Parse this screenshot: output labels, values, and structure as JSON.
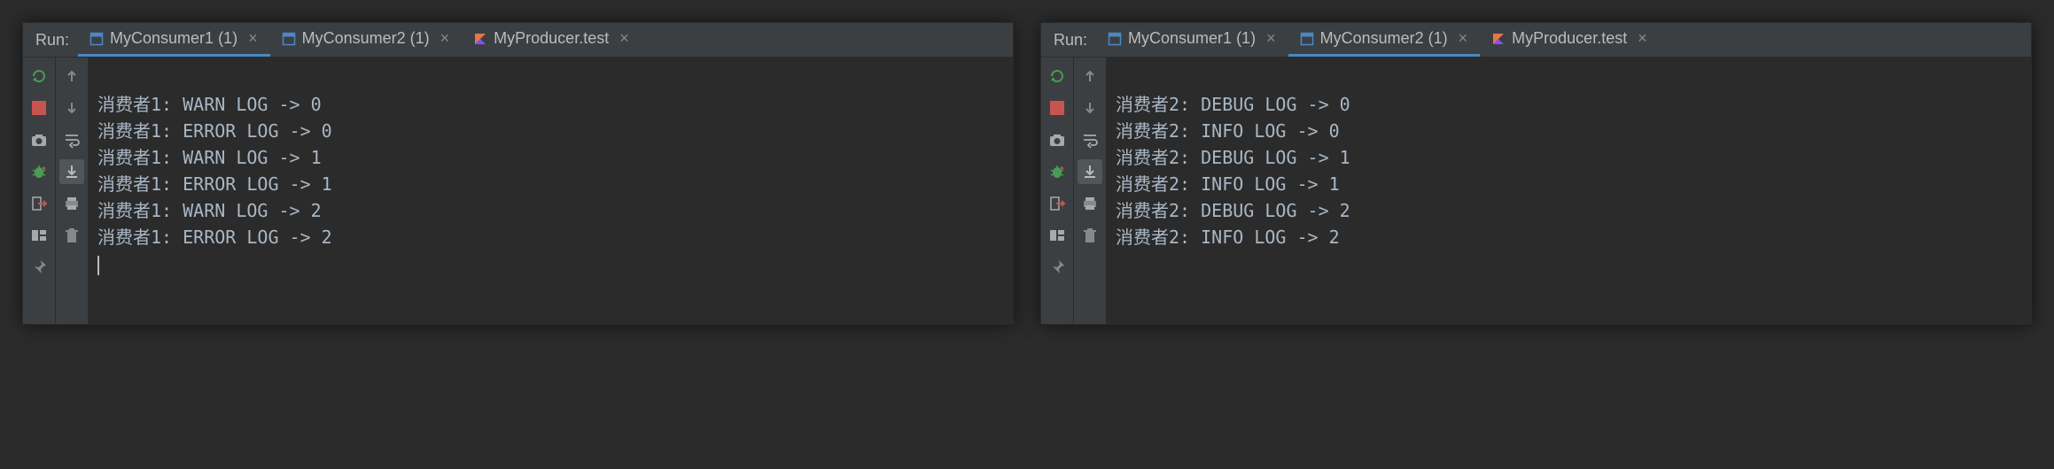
{
  "panels": [
    {
      "run_label": "Run:",
      "tabs": [
        {
          "label": "MyConsumer1 (1)",
          "icon": "app",
          "active": true
        },
        {
          "label": "MyConsumer2 (1)",
          "icon": "app",
          "active": false
        },
        {
          "label": "MyProducer.test",
          "icon": "kotlin",
          "active": false
        }
      ],
      "console_lines": [
        "消费者1: WARN LOG -> 0",
        "消费者1: ERROR LOG -> 0",
        "消费者1: WARN LOG -> 1",
        "消费者1: ERROR LOG -> 1",
        "消费者1: WARN LOG -> 2",
        "消费者1: ERROR LOG -> 2"
      ],
      "show_cursor": true
    },
    {
      "run_label": "Run:",
      "tabs": [
        {
          "label": "MyConsumer1 (1)",
          "icon": "app",
          "active": false
        },
        {
          "label": "MyConsumer2 (1)",
          "icon": "app",
          "active": true
        },
        {
          "label": "MyProducer.test",
          "icon": "kotlin",
          "active": false
        }
      ],
      "console_lines": [
        "消费者2: DEBUG LOG -> 0",
        "消费者2: INFO LOG -> 0",
        "消费者2: DEBUG LOG -> 1",
        "消费者2: INFO LOG -> 1",
        "消费者2: DEBUG LOG -> 2",
        "消费者2: INFO LOG -> 2"
      ],
      "show_cursor": false
    }
  ],
  "icons": {
    "rerun": {
      "name": "rerun-icon",
      "color": "#499c54"
    },
    "stop": {
      "name": "stop-icon",
      "color": "#c75450"
    },
    "camera": {
      "name": "camera-icon"
    },
    "bug": {
      "name": "bug-icon",
      "color": "#499c54"
    },
    "exit": {
      "name": "exit-icon"
    },
    "layout": {
      "name": "layout-icon"
    },
    "pin": {
      "name": "pin-icon"
    },
    "up": {
      "name": "arrow-up-icon"
    },
    "down": {
      "name": "arrow-down-icon"
    },
    "wrap": {
      "name": "soft-wrap-icon"
    },
    "scroll": {
      "name": "scroll-end-icon"
    },
    "print": {
      "name": "print-icon"
    },
    "trash": {
      "name": "trash-icon"
    }
  }
}
